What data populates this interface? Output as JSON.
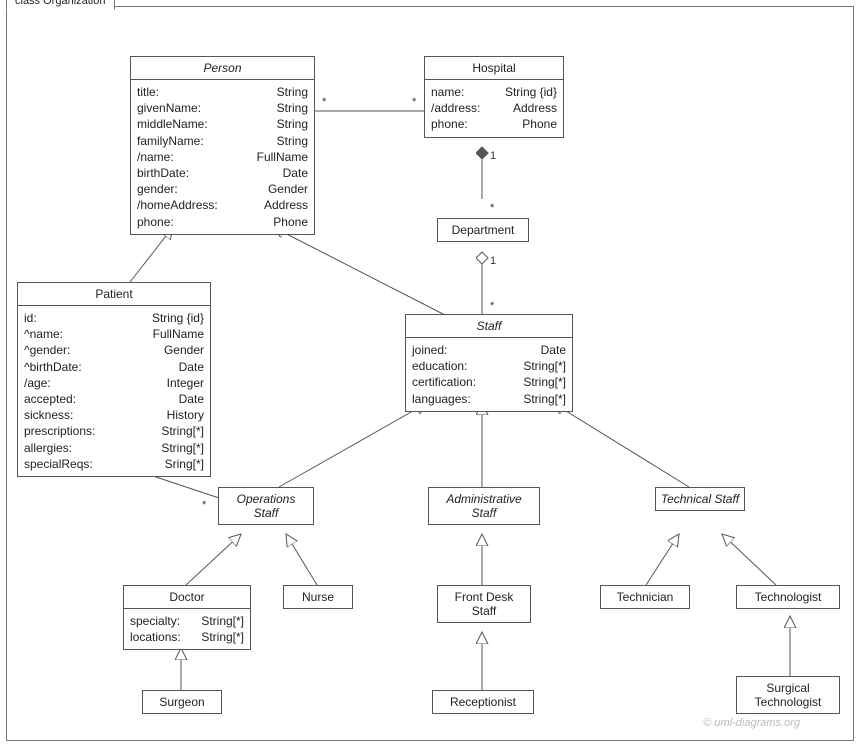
{
  "package": {
    "label": "class Organization"
  },
  "watermark": "© uml-diagrams.org",
  "classes": {
    "person": {
      "name": "Person",
      "abstract": true,
      "attrs": [
        {
          "n": "title:",
          "t": "String"
        },
        {
          "n": "givenName:",
          "t": "String"
        },
        {
          "n": "middleName:",
          "t": "String"
        },
        {
          "n": "familyName:",
          "t": "String"
        },
        {
          "n": "/name:",
          "t": "FullName"
        },
        {
          "n": "birthDate:",
          "t": "Date"
        },
        {
          "n": "gender:",
          "t": "Gender"
        },
        {
          "n": "/homeAddress:",
          "t": "Address"
        },
        {
          "n": "phone:",
          "t": "Phone"
        }
      ]
    },
    "hospital": {
      "name": "Hospital",
      "abstract": false,
      "attrs": [
        {
          "n": "name:",
          "t": "String {id}"
        },
        {
          "n": "/address:",
          "t": "Address"
        },
        {
          "n": "phone:",
          "t": "Phone"
        }
      ]
    },
    "department": {
      "name": "Department",
      "abstract": false,
      "attrs": []
    },
    "staff": {
      "name": "Staff",
      "abstract": true,
      "attrs": [
        {
          "n": "joined:",
          "t": "Date"
        },
        {
          "n": "education:",
          "t": "String[*]"
        },
        {
          "n": "certification:",
          "t": "String[*]"
        },
        {
          "n": "languages:",
          "t": "String[*]"
        }
      ]
    },
    "patient": {
      "name": "Patient",
      "abstract": false,
      "attrs": [
        {
          "n": "id:",
          "t": "String {id}"
        },
        {
          "n": "^name:",
          "t": "FullName"
        },
        {
          "n": "^gender:",
          "t": "Gender"
        },
        {
          "n": "^birthDate:",
          "t": "Date"
        },
        {
          "n": "/age:",
          "t": "Integer"
        },
        {
          "n": "accepted:",
          "t": "Date"
        },
        {
          "n": "sickness:",
          "t": "History"
        },
        {
          "n": "prescriptions:",
          "t": "String[*]"
        },
        {
          "n": "allergies:",
          "t": "String[*]"
        },
        {
          "n": "specialReqs:",
          "t": "Sring[*]"
        }
      ]
    },
    "opstaff": {
      "name": "Operations Staff",
      "abstract": true,
      "attrs": []
    },
    "adminstaff": {
      "name": "Administrative Staff",
      "abstract": true,
      "attrs": []
    },
    "techstaff": {
      "name": "Technical Staff",
      "abstract": true,
      "attrs": []
    },
    "doctor": {
      "name": "Doctor",
      "abstract": false,
      "attrs": [
        {
          "n": "specialty:",
          "t": "String[*]"
        },
        {
          "n": "locations:",
          "t": "String[*]"
        }
      ]
    },
    "nurse": {
      "name": "Nurse",
      "abstract": false,
      "attrs": []
    },
    "frontdesk": {
      "name": "Front Desk Staff",
      "abstract": false,
      "attrs": []
    },
    "receptionist": {
      "name": "Receptionist",
      "abstract": false,
      "attrs": []
    },
    "technician": {
      "name": "Technician",
      "abstract": false,
      "attrs": []
    },
    "technologist": {
      "name": "Technologist",
      "abstract": false,
      "attrs": []
    },
    "surgeon": {
      "name": "Surgeon",
      "abstract": false,
      "attrs": []
    },
    "surgtech": {
      "name": "Surgical Technologist",
      "abstract": false,
      "attrs": []
    }
  },
  "mult": {
    "m1": "*",
    "m2": "*",
    "m3": "1",
    "m4": "*",
    "m5": "1",
    "m6": "*",
    "m7": "*",
    "m8": "*"
  }
}
